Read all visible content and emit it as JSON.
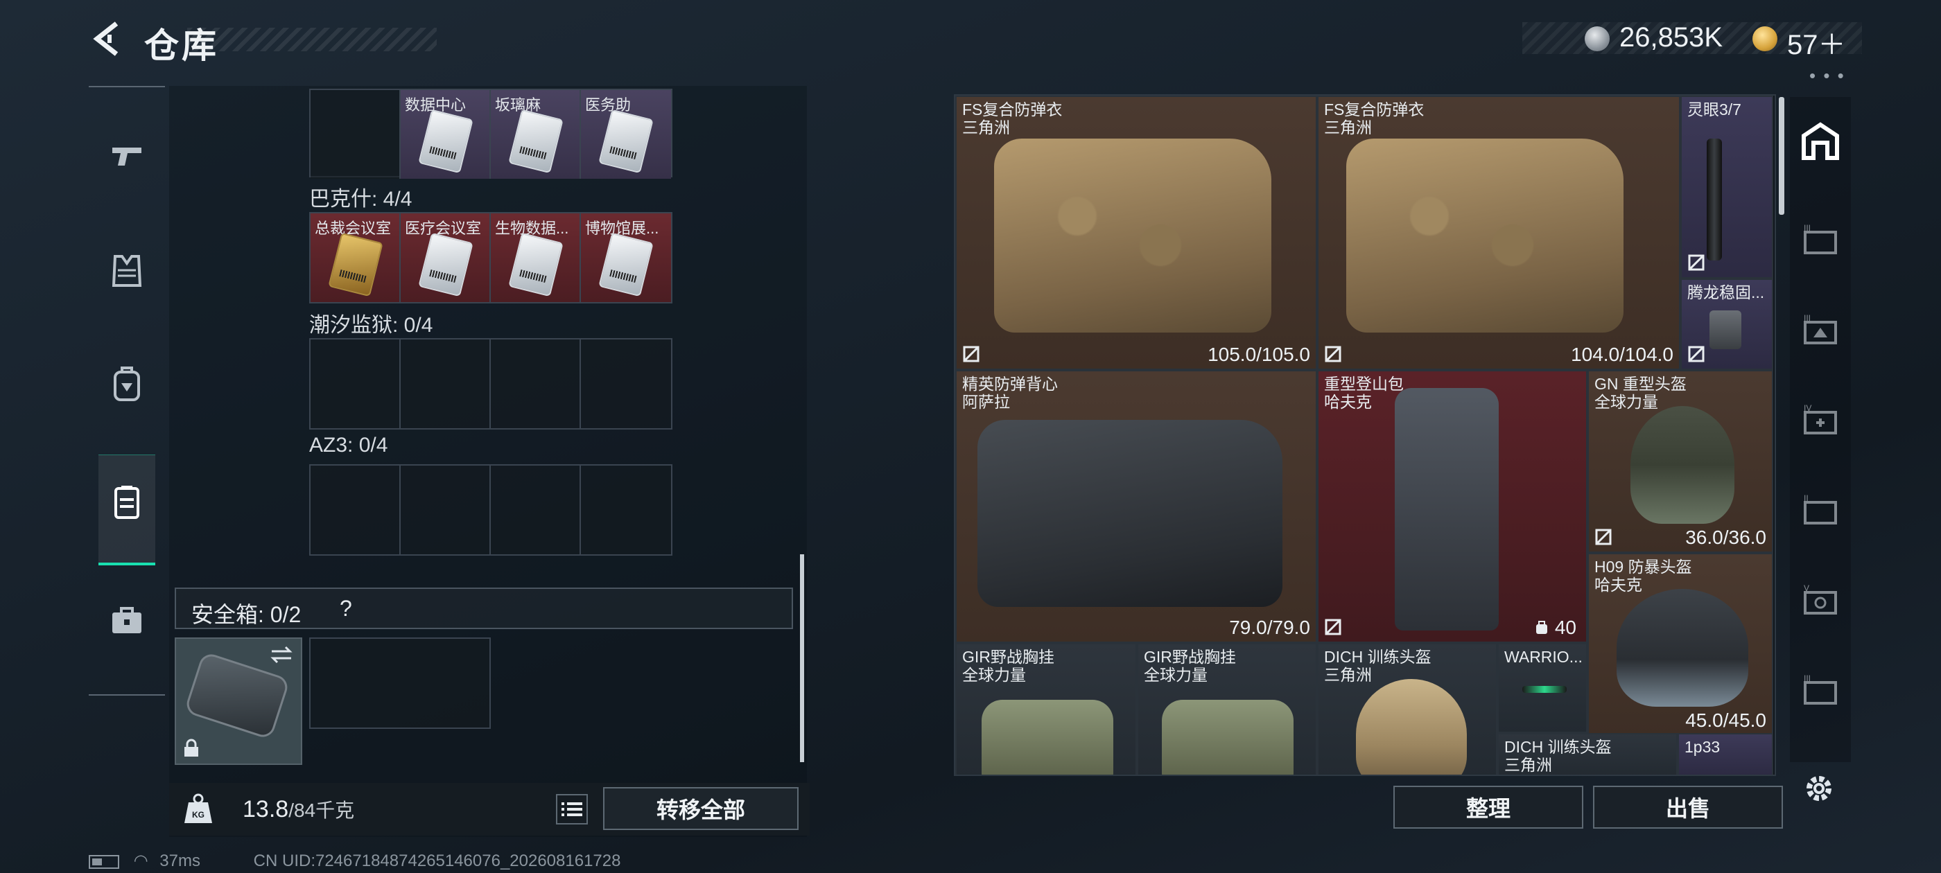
{
  "header": {
    "title": "仓库",
    "currency_silver": "26,853K",
    "currency_gold": "57＋"
  },
  "left_nav": {
    "items": [
      "gun-icon",
      "vest-icon",
      "backpack-icon",
      "container-icon",
      "briefcase-icon"
    ],
    "active_index": 3
  },
  "keycards": {
    "top_row": [
      {
        "name": "数据中心"
      },
      {
        "name": "坂璃麻"
      },
      {
        "name": "医务助"
      }
    ],
    "bakesh_label": "巴克什: 4/4",
    "bakesh_row": [
      {
        "name": "总裁会议室"
      },
      {
        "name": "医疗会议室"
      },
      {
        "name": "生物数据..."
      },
      {
        "name": "博物馆展..."
      }
    ],
    "chaoxi_label": "潮汐监狱: 0/4",
    "az3_label": "AZ3: 0/4"
  },
  "safebox": {
    "label": "安全箱: 0/2",
    "help": "?"
  },
  "weight": {
    "current": "13.8",
    "max": "/84千克",
    "transfer_all": "转移全部"
  },
  "inventory": [
    {
      "name": "FS复合防弹衣",
      "sub": "三角洲",
      "value": "105.0/105.0"
    },
    {
      "name": "FS复合防弹衣",
      "sub": "三角洲",
      "value": "104.0/104.0"
    },
    {
      "name": "灵眼3/7"
    },
    {
      "name": "腾龙稳固..."
    },
    {
      "name": "精英防弹背心",
      "sub": "阿萨拉",
      "value": "79.0/79.0"
    },
    {
      "name": "重型登山包",
      "sub": "哈夫克",
      "value": "40"
    },
    {
      "name": "GN 重型头盔",
      "sub": "全球力量",
      "value": "36.0/36.0"
    },
    {
      "name": "H09 防暴头盔",
      "sub": "哈夫克",
      "value": "45.0/45.0"
    },
    {
      "name": "GIR野战胸挂",
      "sub": "全球力量"
    },
    {
      "name": "GIR野战胸挂",
      "sub": "全球力量"
    },
    {
      "name": "DICH 训练头盔",
      "sub": "三角洲"
    },
    {
      "name": "WARRIO..."
    },
    {
      "name": "DICH 训练头盔",
      "sub": "三角洲"
    },
    {
      "name": "1p33"
    }
  ],
  "actions": {
    "sort": "整理",
    "sell": "出售"
  },
  "status_bar": {
    "ping": "37ms",
    "uid": "CN UID:7246718487426514607​6_202608161728"
  },
  "colors": {
    "accent": "#19e0b0",
    "rarity_red": "#5a2228",
    "rarity_purple": "#3d3a58",
    "rarity_gold": "#4b3a30"
  }
}
